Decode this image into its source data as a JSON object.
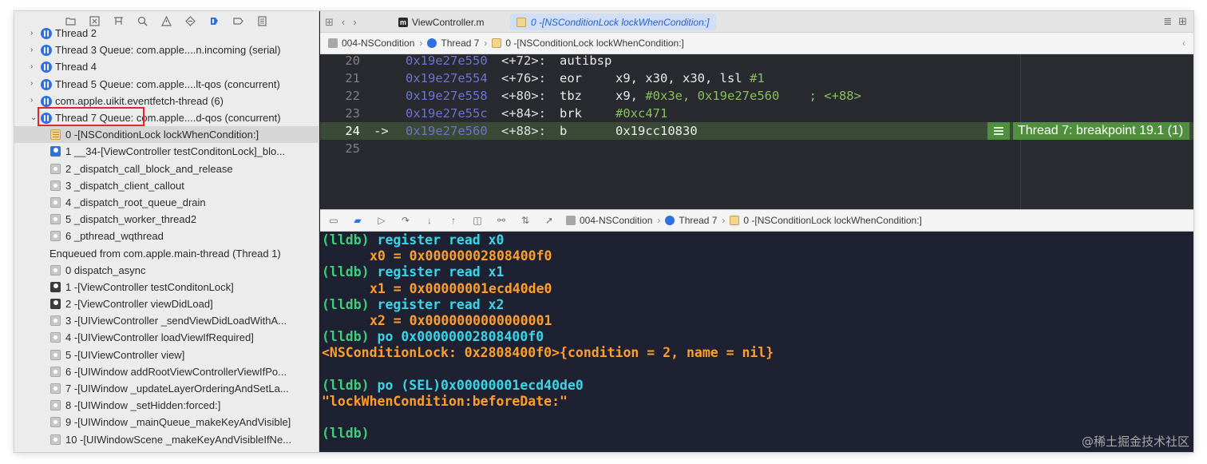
{
  "navigator": {
    "toolbar_icons": [
      "folder-icon",
      "x-square-icon",
      "hierarchy-icon",
      "search-icon",
      "warning-icon",
      "diamond-icon",
      "debug-icon",
      "breakpoint-icon",
      "report-icon"
    ],
    "rows": [
      {
        "kind": "thread",
        "label": "Thread 2",
        "disc": "›"
      },
      {
        "kind": "thread",
        "label": "Thread 3 Queue: com.apple....n.incoming (serial)",
        "disc": "›"
      },
      {
        "kind": "thread",
        "label": "Thread 4",
        "disc": "›"
      },
      {
        "kind": "thread",
        "label": "Thread 5 Queue: com.apple....lt-qos (concurrent)",
        "disc": "›"
      },
      {
        "kind": "thread",
        "label": "com.apple.uikit.eventfetch-thread (6)",
        "disc": "›"
      },
      {
        "kind": "thread",
        "label": "Thread 7 Queue: com.apple....d-qos (concurrent)",
        "disc": "⌄"
      },
      {
        "kind": "frame",
        "icon": "lock",
        "label": "0 -[NSConditionLock lockWhenCondition:]",
        "selected": true
      },
      {
        "kind": "frame",
        "icon": "person-blue",
        "label": "1 __34-[ViewController testConditonLock]_blo..."
      },
      {
        "kind": "frame",
        "icon": "gear",
        "label": "2 _dispatch_call_block_and_release"
      },
      {
        "kind": "frame",
        "icon": "gear",
        "label": "3 _dispatch_client_callout"
      },
      {
        "kind": "frame",
        "icon": "gear",
        "label": "4 _dispatch_root_queue_drain"
      },
      {
        "kind": "frame",
        "icon": "gear",
        "label": "5 _dispatch_worker_thread2"
      },
      {
        "kind": "frame",
        "icon": "gear",
        "label": "6 _pthread_wqthread"
      },
      {
        "kind": "enqueued",
        "label": "Enqueued from com.apple.main-thread (Thread 1)"
      },
      {
        "kind": "frame",
        "icon": "gear",
        "label": "0 dispatch_async"
      },
      {
        "kind": "frame",
        "icon": "person",
        "label": "1 -[ViewController testConditonLock]"
      },
      {
        "kind": "frame",
        "icon": "person",
        "label": "2 -[ViewController viewDidLoad]"
      },
      {
        "kind": "frame",
        "icon": "gear",
        "label": "3 -[UIViewController _sendViewDidLoadWithA..."
      },
      {
        "kind": "frame",
        "icon": "gear",
        "label": "4 -[UIViewController loadViewIfRequired]"
      },
      {
        "kind": "frame",
        "icon": "gear",
        "label": "5 -[UIViewController view]"
      },
      {
        "kind": "frame",
        "icon": "gear",
        "label": "6 -[UIWindow addRootViewControllerViewIfPo..."
      },
      {
        "kind": "frame",
        "icon": "gear",
        "label": "7 -[UIWindow _updateLayerOrderingAndSetLa..."
      },
      {
        "kind": "frame",
        "icon": "gear",
        "label": "8 -[UIWindow _setHidden:forced:]"
      },
      {
        "kind": "frame",
        "icon": "gear",
        "label": "9 -[UIWindow _mainQueue_makeKeyAndVisible]"
      },
      {
        "kind": "frame",
        "icon": "gear",
        "label": "10 -[UIWindowScene _makeKeyAndVisibleIfNe..."
      }
    ]
  },
  "tabs": {
    "file_tab": "ViewController.m",
    "file_badge": "m",
    "active_tab": "0 -[NSConditionLock lockWhenCondition:]"
  },
  "jumpbar": {
    "project": "004-NSCondition",
    "thread": "Thread 7",
    "frame": "0 -[NSConditionLock lockWhenCondition:]",
    "right_glyph": "‹"
  },
  "disassembly": {
    "lines": [
      {
        "ln": "20",
        "arrow": "",
        "addr": "0x19e27e550",
        "off": "<+72>:",
        "mn": "autibsp",
        "ops": "",
        "num": "",
        "cmt": ""
      },
      {
        "ln": "21",
        "arrow": "",
        "addr": "0x19e27e554",
        "off": "<+76>:",
        "mn": "eor",
        "ops": "x9, x30, x30, lsl ",
        "num": "#1",
        "cmt": ""
      },
      {
        "ln": "22",
        "arrow": "",
        "addr": "0x19e27e558",
        "off": "<+80>:",
        "mn": "tbz",
        "ops": "x9, ",
        "num": "#0x3e",
        "cmt": ", 0x19e27e560    ; <+88>"
      },
      {
        "ln": "23",
        "arrow": "",
        "addr": "0x19e27e55c",
        "off": "<+84>:",
        "mn": "brk",
        "ops": "",
        "num": "#0xc471",
        "cmt": ""
      },
      {
        "ln": "24",
        "arrow": "->",
        "addr": "0x19e27e560",
        "off": "<+88>:",
        "mn": "b",
        "ops": "0x19cc10830",
        "num": "",
        "cmt": "",
        "current": true
      },
      {
        "ln": "25",
        "arrow": "",
        "addr": "",
        "off": "",
        "mn": "",
        "ops": "",
        "num": "",
        "cmt": ""
      }
    ],
    "breakpoint_label": "Thread 7: breakpoint 19.1 (1)"
  },
  "debugbar": {
    "project": "004-NSCondition",
    "thread": "Thread 7",
    "frame": "0 -[NSConditionLock lockWhenCondition:]"
  },
  "console": {
    "lines": [
      {
        "type": "cmd",
        "prompt": "(lldb)",
        "text": " register read x0"
      },
      {
        "type": "out",
        "indent": true,
        "text": "x0 = 0x00000002808400f0"
      },
      {
        "type": "cmd",
        "prompt": "(lldb)",
        "text": " register read x1"
      },
      {
        "type": "out",
        "indent": true,
        "text": "x1 = 0x00000001ecd40de0"
      },
      {
        "type": "cmd",
        "prompt": "(lldb)",
        "text": " register read x2"
      },
      {
        "type": "out",
        "indent": true,
        "text": "x2 = 0x0000000000000001"
      },
      {
        "type": "cmd",
        "prompt": "(lldb)",
        "text": " po 0x00000002808400f0"
      },
      {
        "type": "out",
        "indent": false,
        "text": "<NSConditionLock: 0x2808400f0>{condition = 2, name = nil}"
      },
      {
        "type": "blank",
        "text": ""
      },
      {
        "type": "cmd",
        "prompt": "(lldb)",
        "text": " po (SEL)0x00000001ecd40de0"
      },
      {
        "type": "out",
        "indent": false,
        "text": "\"lockWhenCondition:beforeDate:\""
      },
      {
        "type": "blank",
        "text": ""
      },
      {
        "type": "cmd",
        "prompt": "(lldb)",
        "text": ""
      }
    ]
  },
  "watermark": "@稀土掘金技术社区"
}
